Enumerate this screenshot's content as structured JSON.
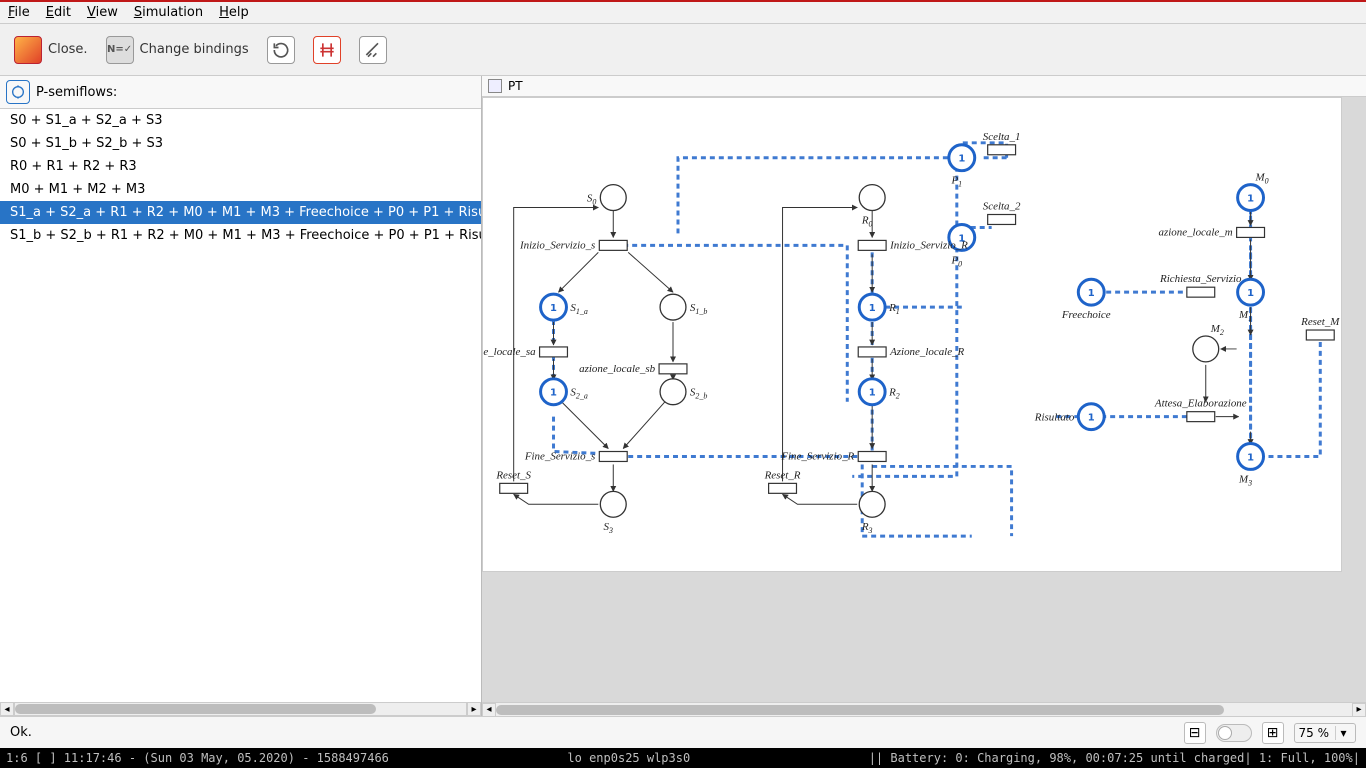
{
  "menu": {
    "file": "File",
    "edit": "Edit",
    "view": "View",
    "simulation": "Simulation",
    "help": "Help"
  },
  "toolbar": {
    "close": "Close.",
    "change_bindings": "Change bindings",
    "bind_icon_text": "N=✓"
  },
  "left": {
    "title": "P-semiflows:",
    "rows": [
      "S0 + S1_a + S2_a + S3",
      "S0 + S1_b + S2_b + S3",
      "R0 + R1 + R2 + R3",
      "M0 + M1 + M2 + M3",
      "S1_a + S2_a + R1 + R2 + M0 + M1 + M3 + Freechoice + P0 + P1 + Risu",
      "S1_b + S2_b + R1 + R2 + M0 + M1 + M3 + Freechoice + P0 + P1 + Risu"
    ],
    "selected_index": 4
  },
  "canvas": {
    "tab": "PT"
  },
  "petri": {
    "places": {
      "S0": {
        "label": "S0"
      },
      "S1_a": {
        "label": "S1_a"
      },
      "S1_b": {
        "label": "S1_b"
      },
      "S2_a": {
        "label": "S2_a"
      },
      "S2_b": {
        "label": "S2_b"
      },
      "S3": {
        "label": "S3"
      },
      "R0": {
        "label": "R0"
      },
      "R1": {
        "label": "R1"
      },
      "R2": {
        "label": "R2"
      },
      "R3": {
        "label": "R3"
      },
      "P0": {
        "label": "P0"
      },
      "P1": {
        "label": "P1"
      },
      "Freechoice": {
        "label": "Freechoice"
      },
      "Risultato": {
        "label": "Risultato"
      },
      "M0": {
        "label": "M0"
      },
      "M1": {
        "label": "M1"
      },
      "M2": {
        "label": "M2"
      },
      "M3": {
        "label": "M3"
      }
    },
    "transitions": {
      "Inizio_Servizio_s": "Inizio_Servizio_s",
      "azione_locale_sa": "azione_locale_sa",
      "azione_locale_sb": "azione_locale_sb",
      "Fine_Servizio_s": "Fine_Servizio_s",
      "Reset_S": "Reset_S",
      "Inizio_Servizio_R": "Inizio_Servizio_R",
      "Azione_locale_R": "Azione_locale_R",
      "Fine_Servizio_R": "Fine_Servizio_R",
      "Reset_R": "Reset_R",
      "Scelta_1": "Scelta_1",
      "Scelta_2": "Scelta_2",
      "azione_locale_m": "azione_locale_m",
      "Richiesta_Servizio": "Richiesta_Servizio",
      "Attesa_Elaborazione": "Attesa_Elaborazione",
      "Reset_M": "Reset_M"
    },
    "token": "1"
  },
  "status": {
    "text": "Ok.",
    "zoom": "75 %"
  },
  "sysbar": {
    "left": "1:6 [ ]   11:17:46 - (Sun 03 May, 05.2020) - 1588497466",
    "mid": "lo enp0s25 wlp3s0",
    "right": "||  Battery: 0: Charging, 98%, 00:07:25 until charged| 1: Full, 100%|"
  },
  "colors": {
    "accent": "#2874c6",
    "selection": "#2874c6",
    "highlight_dash": "#1e63c9"
  }
}
